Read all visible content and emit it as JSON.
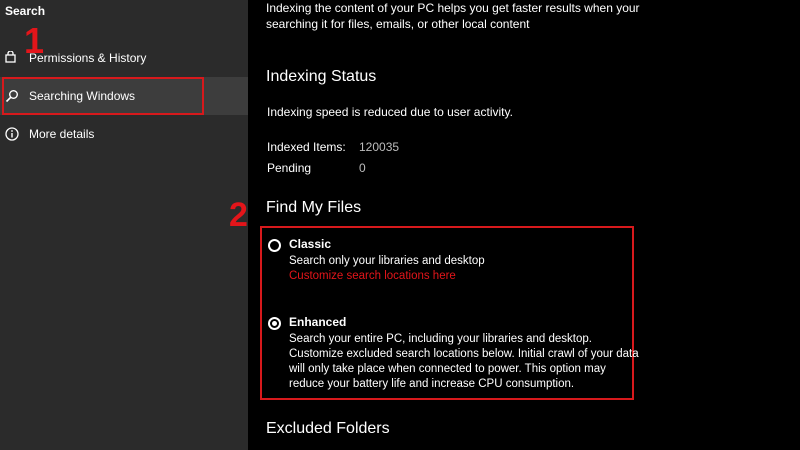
{
  "sidebar": {
    "title": "Search",
    "items": [
      {
        "label": "Permissions & History",
        "icon": "lock-history-icon"
      },
      {
        "label": "Searching Windows",
        "icon": "search-icon"
      },
      {
        "label": "More details",
        "icon": "info-icon"
      }
    ]
  },
  "annotations": {
    "step1": "1",
    "step2": "2",
    "color": "#e3151a"
  },
  "main": {
    "intro": "Indexing the content of your PC helps you get faster results when your searching it for files, emails, or other local content",
    "indexing_status": {
      "title": "Indexing Status",
      "message": "Indexing speed is reduced due to user activity.",
      "indexed_label": "Indexed Items:",
      "indexed_value": "120035",
      "pending_label": "Pending",
      "pending_value": "0"
    },
    "find_my_files": {
      "title": "Find My Files",
      "classic": {
        "label": "Classic",
        "description": "Search only your libraries and desktop",
        "link": "Customize search locations here"
      },
      "enhanced": {
        "label": "Enhanced",
        "description": "Search your entire PC, including your libraries and desktop. Customize excluded search locations below. Initial crawl of your data will only take place when connected to power. This option may reduce your battery life and increase CPU consumption."
      },
      "selected": "enhanced"
    },
    "excluded_folders": {
      "title": "Excluded Folders"
    }
  }
}
